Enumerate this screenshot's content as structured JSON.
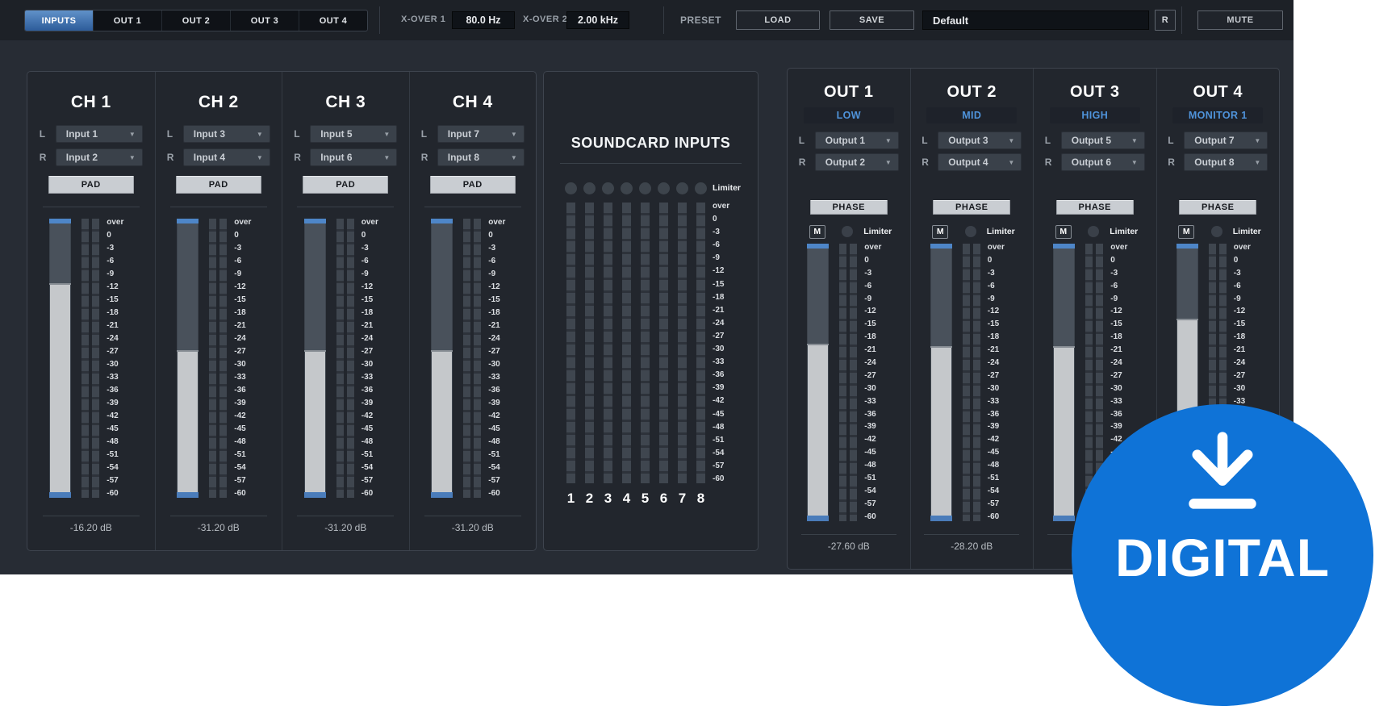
{
  "topbar": {
    "tabs": [
      {
        "label": "INPUTS",
        "active": true
      },
      {
        "label": "OUT 1",
        "active": false
      },
      {
        "label": "OUT 2",
        "active": false
      },
      {
        "label": "OUT 3",
        "active": false
      },
      {
        "label": "OUT 4",
        "active": false
      }
    ],
    "xover1_label": "X-OVER 1",
    "xover1_value": "80.0 Hz",
    "xover2_label": "X-OVER 2",
    "xover2_value": "2.00 kHz",
    "preset_label": "PRESET",
    "load_label": "LOAD",
    "save_label": "SAVE",
    "preset_name": "Default",
    "reset_button": "R",
    "mute_label": "MUTE"
  },
  "meter_scale": [
    "over",
    "0",
    "-3",
    "-6",
    "-9",
    "-12",
    "-15",
    "-18",
    "-21",
    "-24",
    "-27",
    "-30",
    "-33",
    "-36",
    "-39",
    "-42",
    "-45",
    "-48",
    "-51",
    "-54",
    "-57",
    "-60"
  ],
  "inputs": {
    "channels": [
      {
        "title": "CH 1",
        "l_label": "L",
        "l_value": "Input 1",
        "r_label": "R",
        "r_value": "Input 2",
        "pad_label": "PAD",
        "gain_readout": "-16.20 dB",
        "fader_top_pct": 23
      },
      {
        "title": "CH 2",
        "l_label": "L",
        "l_value": "Input 3",
        "r_label": "R",
        "r_value": "Input 4",
        "pad_label": "PAD",
        "gain_readout": "-31.20 dB",
        "fader_top_pct": 47
      },
      {
        "title": "CH 3",
        "l_label": "L",
        "l_value": "Input 5",
        "r_label": "R",
        "r_value": "Input 6",
        "pad_label": "PAD",
        "gain_readout": "-31.20 dB",
        "fader_top_pct": 47
      },
      {
        "title": "CH 4",
        "l_label": "L",
        "l_value": "Input 7",
        "r_label": "R",
        "r_value": "Input 8",
        "pad_label": "PAD",
        "gain_readout": "-31.20 dB",
        "fader_top_pct": 47
      }
    ]
  },
  "soundcard": {
    "title": "SOUNDCARD INPUTS",
    "limiter_label": "Limiter",
    "channels": [
      "1",
      "2",
      "3",
      "4",
      "5",
      "6",
      "7",
      "8"
    ]
  },
  "outputs": {
    "columns": [
      {
        "title": "OUT 1",
        "band": "LOW",
        "l_label": "L",
        "l_value": "Output 1",
        "r_label": "R",
        "r_value": "Output 2",
        "phase_label": "PHASE",
        "mute_button": "M",
        "limiter_label": "Limiter",
        "gain_readout": "-27.60 dB",
        "fader_top_pct": 36
      },
      {
        "title": "OUT 2",
        "band": "MID",
        "l_label": "L",
        "l_value": "Output 3",
        "r_label": "R",
        "r_value": "Output 4",
        "phase_label": "PHASE",
        "mute_button": "M",
        "limiter_label": "Limiter",
        "gain_readout": "-28.20 dB",
        "fader_top_pct": 37
      },
      {
        "title": "OUT 3",
        "band": "HIGH",
        "l_label": "L",
        "l_value": "Output 5",
        "r_label": "R",
        "r_value": "Output 6",
        "phase_label": "PHASE",
        "mute_button": "M",
        "limiter_label": "Limiter",
        "gain_readout": "",
        "fader_top_pct": 37
      },
      {
        "title": "OUT 4",
        "band": "MONITOR 1",
        "l_label": "L",
        "l_value": "Output 7",
        "r_label": "R",
        "r_value": "Output 8",
        "phase_label": "PHASE",
        "mute_button": "M",
        "limiter_label": "Limiter",
        "gain_readout": "",
        "fader_top_pct": 27
      }
    ]
  },
  "badge": {
    "label": "DIGITAL"
  },
  "colors": {
    "accent_blue": "#4f93da",
    "tab_active_blue": "#3e6ca5",
    "badge_blue": "#0f73d7",
    "fader_fill_gray": "#c5c8cb"
  }
}
